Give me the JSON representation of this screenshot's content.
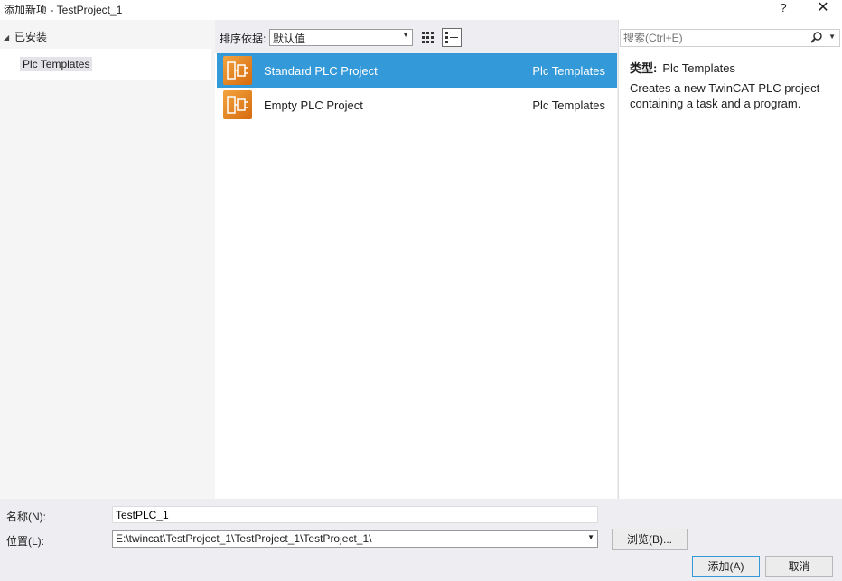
{
  "window": {
    "title": "添加新项 - TestProject_1",
    "help": "?",
    "close": "✕"
  },
  "tree": {
    "header": "已安装",
    "items": [
      {
        "label": "Plc Templates",
        "selected": true
      }
    ]
  },
  "toolbar": {
    "sort_label": "排序依据:",
    "sort_value": "默认值"
  },
  "templates": [
    {
      "name": "Standard PLC Project",
      "category": "Plc Templates",
      "selected": true
    },
    {
      "name": "Empty PLC Project",
      "category": "Plc Templates",
      "selected": false
    }
  ],
  "search": {
    "placeholder": "搜索(Ctrl+E)"
  },
  "details": {
    "type_label": "类型:",
    "type_value": "Plc Templates",
    "description": "Creates a new TwinCAT PLC project containing a task and a program."
  },
  "form": {
    "name_label": "名称(N):",
    "name_value": "TestPLC_1",
    "location_label": "位置(L):",
    "location_value": "E:\\twincat\\TestProject_1\\TestProject_1\\TestProject_1\\",
    "browse_label": "浏览(B)...",
    "add_label": "添加(A)",
    "cancel_label": "取消"
  },
  "colors": {
    "selection": "#3399d8",
    "icon": "#e07d1a"
  }
}
